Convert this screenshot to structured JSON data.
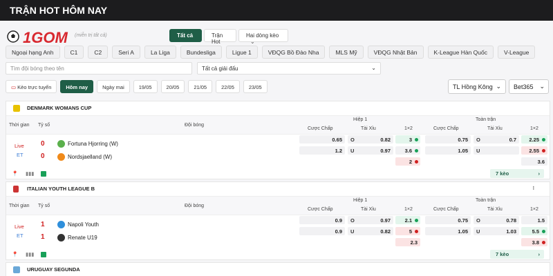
{
  "header": {
    "title": "TRẬN HOT HÔM NAY"
  },
  "logo": {
    "text": "1GOM",
    "tagline": "(Giải thưởng | miễn phí)",
    "sub": "(miễn trị tất cả)"
  },
  "tabs": [
    {
      "label": "Tất cả",
      "active": true
    },
    {
      "label": "Trận Hot",
      "active": false
    },
    {
      "label": "Hai dòng kèo",
      "active": false
    }
  ],
  "leagues": [
    "Ngoại hạng Anh",
    "C1",
    "C2",
    "Seri A",
    "La Liga",
    "Bundesliga",
    "Ligue 1",
    "VĐQG Bồ Đào Nha",
    "MLS Mỹ",
    "VĐQG Nhật Bản",
    "K-League Hàn Quốc",
    "V-League"
  ],
  "search": {
    "placeholder": "Tìm đội bóng theo tên"
  },
  "league_select": {
    "value": "Tất cả giải đấu"
  },
  "dates": [
    {
      "label": "Kèo trực tuyến",
      "active": false
    },
    {
      "label": "Hôm nay",
      "active": true
    },
    {
      "label": "Ngày mai",
      "active": false
    },
    {
      "label": "19/05",
      "active": false
    },
    {
      "label": "20/05",
      "active": false
    },
    {
      "label": "21/05",
      "active": false
    },
    {
      "label": "22/05",
      "active": false
    },
    {
      "label": "23/05",
      "active": false
    }
  ],
  "odds_format": {
    "value": "TL Hồng Kông"
  },
  "bookmaker": {
    "value": "Bet365"
  },
  "table_headers": {
    "time": "Thời gian",
    "score": "Tỷ số",
    "teams": "Đội bóng",
    "half": "Hiệp 1",
    "full": "Toàn trận",
    "handicap": "Cược Chấp",
    "overunder": "Tài Xỉu",
    "x12": "1×2"
  },
  "competitions": [
    {
      "name": "DENMARK WOMANS CUP",
      "status": "Live",
      "period": "ET",
      "home": {
        "name": "Fortuna Hjorring (W)",
        "score": "0"
      },
      "away": {
        "name": "Nordsjaelland (W)",
        "score": "0"
      },
      "half": {
        "hdp": [
          "0.65",
          "1.2"
        ],
        "ou_labels": [
          "O",
          "U"
        ],
        "ou": [
          "0.82",
          "0.97"
        ],
        "x12": [
          "3",
          "3.6",
          "2"
        ]
      },
      "full": {
        "hdp": [
          "0.75",
          "1.05"
        ],
        "ou_labels": [
          "O",
          "U"
        ],
        "ou": [
          "0.7",
          ""
        ],
        "x12": [
          "2.25",
          "2.55",
          "3.6"
        ]
      },
      "more": "7 kèo"
    },
    {
      "name": "ITALIAN YOUTH LEAGUE B",
      "status": "Live",
      "period": "ET",
      "home": {
        "name": "Napoli Youth",
        "score": "1"
      },
      "away": {
        "name": "Renate U19",
        "score": "1"
      },
      "half": {
        "hdp": [
          "0.9",
          "0.9"
        ],
        "ou_labels": [
          "O",
          "U"
        ],
        "ou": [
          "0.97",
          "0.82"
        ],
        "x12": [
          "2.1",
          "5",
          "2.3"
        ]
      },
      "full": {
        "hdp": [
          "0.75",
          "1.05"
        ],
        "ou_labels": [
          "O",
          "U"
        ],
        "ou": [
          "0.78",
          "1.03"
        ],
        "x12": [
          "1.5",
          "5.5",
          "3.8"
        ]
      },
      "more": "7 kèo"
    },
    {
      "name": "URUGUAY SEGUNDA"
    }
  ],
  "colors": {
    "accent": "#1f5e47",
    "live": "#d02020",
    "up": "#18a058"
  }
}
